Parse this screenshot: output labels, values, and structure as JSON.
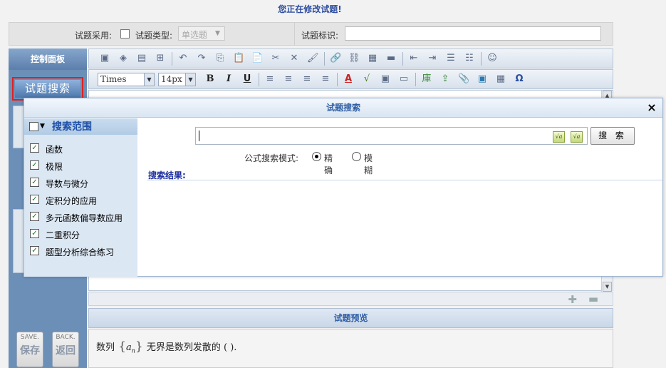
{
  "page": {
    "notice": "您正在修改试题!"
  },
  "attributes": {
    "adopt_label": "试题采用:",
    "type_label": "试题类型:",
    "type_value": "单选题",
    "tag_label": "试题标识:",
    "tag_value": ""
  },
  "sidebar": {
    "panel_title": "控制面板",
    "search_button": "试题搜索",
    "save": {
      "en": "SAVE.",
      "cn": "保存"
    },
    "back": {
      "en": "BACK.",
      "cn": "返回"
    }
  },
  "editor": {
    "font_name": "Times",
    "font_size": "14px",
    "bold": "B",
    "italic": "I",
    "underline": "U"
  },
  "preview": {
    "title": "试题预览",
    "text_before": "数列",
    "math_var": "a",
    "math_sub": "n",
    "text_after": "无界是数列发散的 ( )."
  },
  "dialog": {
    "title": "试题搜索",
    "close": "×",
    "scope_title": "搜索范围",
    "scope_items": [
      "函数",
      "极限",
      "导数与微分",
      "定积分的应用",
      "多元函数偏导数应用",
      "二重积分",
      "题型分析综合练习"
    ],
    "search_value": "",
    "search_button": "搜 索",
    "mode_label": "公式搜索模式:",
    "mode_exact": "精确",
    "mode_fuzzy": "模糊",
    "results_label": "搜索结果:"
  }
}
